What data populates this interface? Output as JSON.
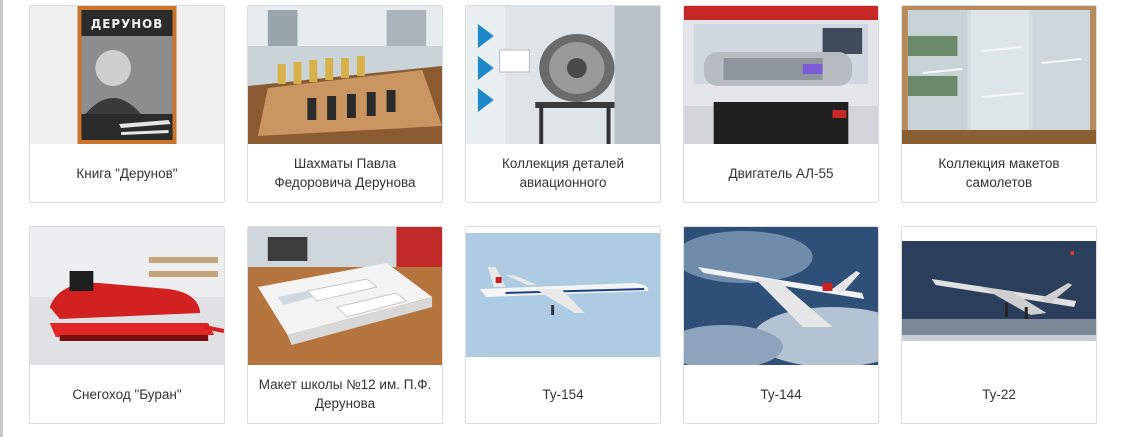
{
  "gallery": {
    "items": [
      {
        "caption": "Книга \"Дерунов\"",
        "image_text": "ДЕРУНОВ"
      },
      {
        "caption": "Шахматы Павла Федоровича Дерунова"
      },
      {
        "caption": "Коллекция деталей авиационного"
      },
      {
        "caption": "Двигатель АЛ-55"
      },
      {
        "caption": "Коллекция макетов самолетов"
      },
      {
        "caption": "Снегоход \"Буран\""
      },
      {
        "caption": "Макет школы №12 им. П.Ф. Дерунова"
      },
      {
        "caption": "Ту-154"
      },
      {
        "caption": "Ту-144"
      },
      {
        "caption": "Ту-22"
      }
    ]
  }
}
